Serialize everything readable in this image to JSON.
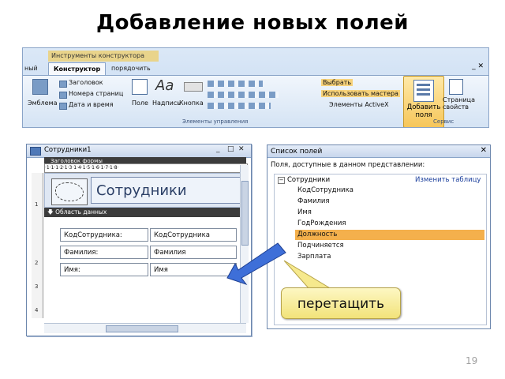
{
  "slide": {
    "title": "Добавление новых полей",
    "page_number": "19"
  },
  "ribbon": {
    "context_tab": "Инструменты конструктора форм",
    "tabs": [
      "ный",
      "Конструктор",
      "порядочить"
    ],
    "active_tab": "Конструктор",
    "buttons": {
      "emblem": "Эмблема",
      "header": "Заголовок",
      "page_numbers": "Номера страниц",
      "date_time": "Дата и время",
      "field": "Поле",
      "label": "Надпись",
      "button": "Кнопка",
      "select": "Выбрать",
      "use_wizard": "Использовать мастера",
      "activex": "Элементы ActiveX",
      "add_fields_line1": "Добавить",
      "add_fields_line2": "поля",
      "property_sheet_line1": "Страница",
      "property_sheet_line2": "свойств"
    },
    "groups": {
      "controls": "Элементы управления",
      "service": "Сервис"
    }
  },
  "form_window": {
    "title": "Сотрудники1",
    "header_band": "Заголовок формы",
    "ruler_text": "·1·1·1·2·1·3·1·4·1·5·1·6·1·7·1·8·",
    "vruler": [
      "1",
      "2",
      "3",
      "4"
    ],
    "form_title": "Сотрудники",
    "detail_band": "Область данных",
    "fields": [
      {
        "label": "КодСотрудника:",
        "value": "КодСотрудника"
      },
      {
        "label": "Фамилия:",
        "value": "Фамилия"
      },
      {
        "label": "Имя:",
        "value": "Имя"
      }
    ]
  },
  "field_list": {
    "title": "Список полей",
    "subtitle": "Поля, доступные в данном представлении:",
    "table": "Сотрудники",
    "change_table": "Изменить таблицу",
    "items": [
      "КодСотрудника",
      "Фамилия",
      "Имя",
      "ГодРождения",
      "Должность",
      "Подчиняется",
      "Зарплата"
    ],
    "selected": "Должность"
  },
  "callout": {
    "text": "перетащить"
  },
  "colors": {
    "selection": "#f4b04c",
    "arrow": "#3e6fd8",
    "callout": "#f6e98d"
  }
}
